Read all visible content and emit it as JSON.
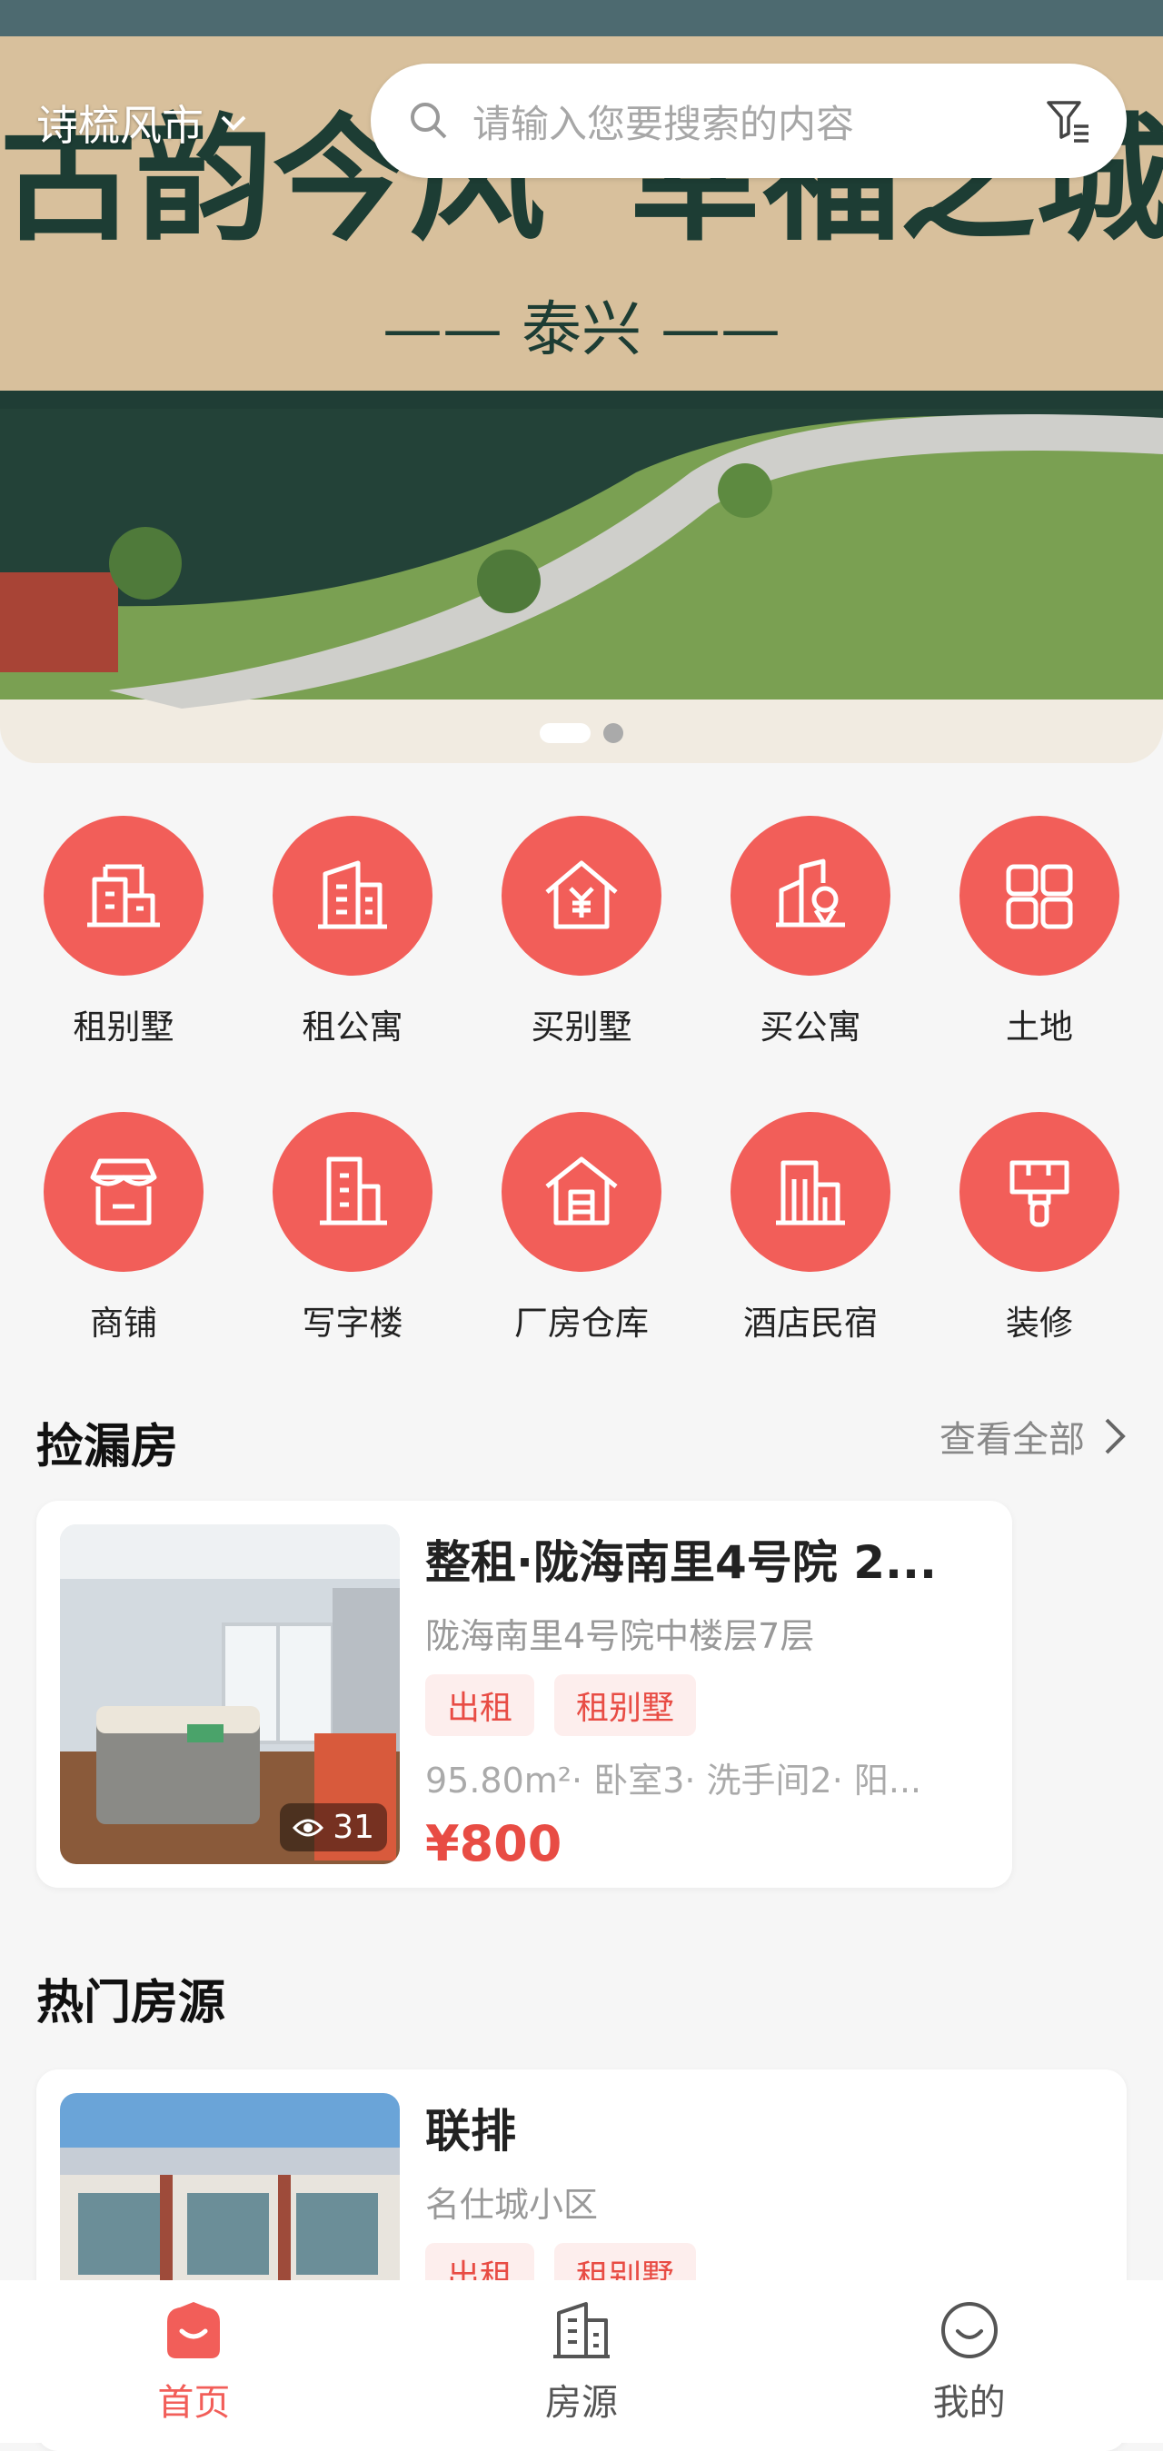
{
  "header": {
    "city": "诗梳风市",
    "search_placeholder": "请输入您要搜索的内容"
  },
  "banner": {
    "headline_left": "古韵今风",
    "headline_right": "幸福之城",
    "subtitle": "—— 泰兴 ——",
    "slide_count": 2,
    "active_slide": 1
  },
  "categories": [
    {
      "label": "租别墅",
      "icon": "villa-icon"
    },
    {
      "label": "租公寓",
      "icon": "apartment-icon"
    },
    {
      "label": "买别墅",
      "icon": "buy-house-icon"
    },
    {
      "label": "买公寓",
      "icon": "buy-apartment-icon"
    },
    {
      "label": "土地",
      "icon": "land-icon"
    },
    {
      "label": "商铺",
      "icon": "shop-icon"
    },
    {
      "label": "写字楼",
      "icon": "office-icon"
    },
    {
      "label": "厂房仓库",
      "icon": "warehouse-icon"
    },
    {
      "label": "酒店民宿",
      "icon": "hotel-icon"
    },
    {
      "label": "装修",
      "icon": "paint-brush-icon"
    }
  ],
  "bargain": {
    "title": "捡漏房",
    "view_all": "查看全部",
    "listing": {
      "title": "整租·陇海南里4号院 2...",
      "address": "陇海南里4号院中楼层7层",
      "tags": [
        "出租",
        "租别墅"
      ],
      "meta": "95.80m²· 卧室3· 洗手间2· 阳...",
      "price": "¥800",
      "views": "31"
    }
  },
  "hot": {
    "title": "热门房源",
    "listing": {
      "title": "联排",
      "address": "名仕城小区",
      "tags": [
        "出租",
        "租别墅"
      ]
    }
  },
  "tabbar": {
    "home": "首页",
    "houses": "房源",
    "mine": "我的"
  },
  "colors": {
    "accent": "#f25e59",
    "price": "#e84c44",
    "tag_bg": "#fdeeed"
  }
}
